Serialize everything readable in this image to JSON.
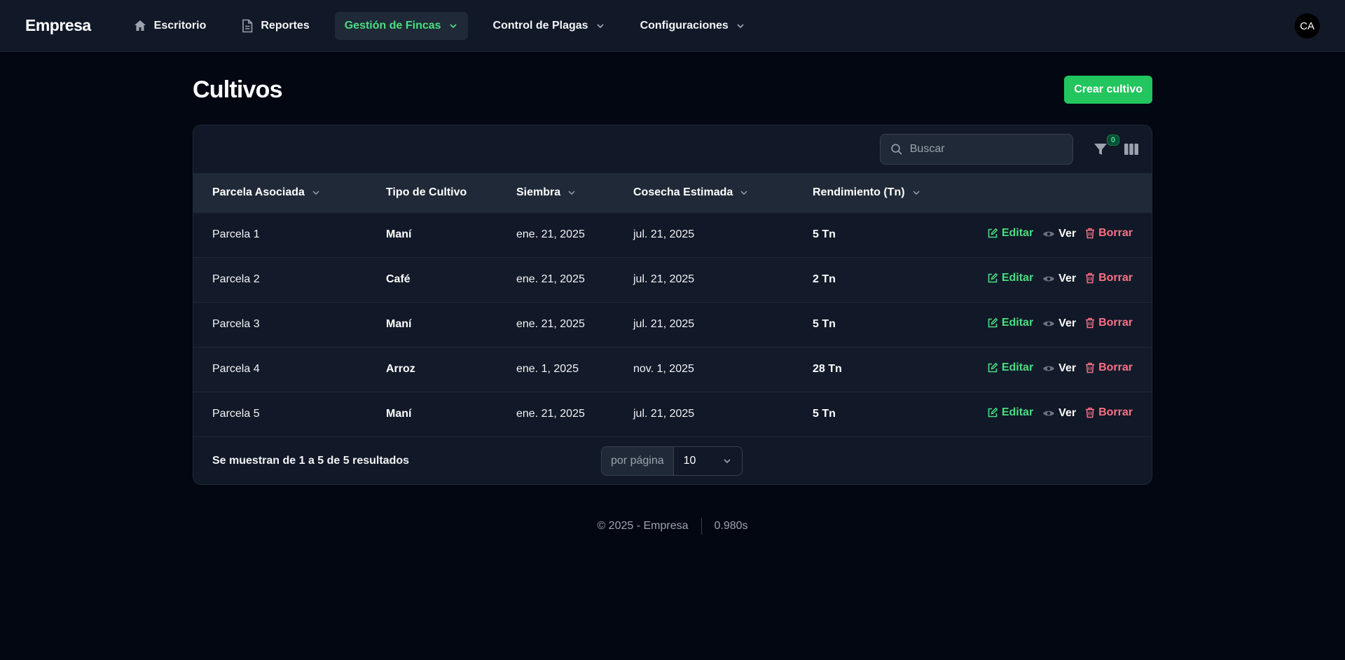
{
  "header": {
    "brand": "Empresa",
    "nav": [
      {
        "label": "Escritorio",
        "icon": "home-icon"
      },
      {
        "label": "Reportes",
        "icon": "document-icon"
      },
      {
        "label": "Gestión de Fincas",
        "icon": "chevron-down-icon",
        "active": true
      },
      {
        "label": "Control de Plagas",
        "icon": "chevron-down-icon"
      },
      {
        "label": "Configuraciones",
        "icon": "chevron-down-icon"
      }
    ],
    "avatar_initials": "CA"
  },
  "page": {
    "title": "Cultivos",
    "create_button": "Crear cultivo"
  },
  "toolbar": {
    "search_placeholder": "Buscar",
    "filter_count": "0"
  },
  "table": {
    "columns": [
      "Parcela Asociada",
      "Tipo de Cultivo",
      "Siembra",
      "Cosecha Estimada",
      "Rendimiento (Tn)"
    ],
    "actions": {
      "edit": "Editar",
      "view": "Ver",
      "delete": "Borrar"
    },
    "rows": [
      {
        "parcela": "Parcela 1",
        "tipo": "Maní",
        "siembra": "ene. 21, 2025",
        "cosecha": "jul. 21, 2025",
        "rendimiento": "5 Tn"
      },
      {
        "parcela": "Parcela 2",
        "tipo": "Café",
        "siembra": "ene. 21, 2025",
        "cosecha": "jul. 21, 2025",
        "rendimiento": "2 Tn"
      },
      {
        "parcela": "Parcela 3",
        "tipo": "Maní",
        "siembra": "ene. 21, 2025",
        "cosecha": "jul. 21, 2025",
        "rendimiento": "5 Tn"
      },
      {
        "parcela": "Parcela 4",
        "tipo": "Arroz",
        "siembra": "ene. 1, 2025",
        "cosecha": "nov. 1, 2025",
        "rendimiento": "28 Tn"
      },
      {
        "parcela": "Parcela 5",
        "tipo": "Maní",
        "siembra": "ene. 21, 2025",
        "cosecha": "jul. 21, 2025",
        "rendimiento": "5 Tn"
      }
    ]
  },
  "pagination": {
    "summary": "Se muestran de 1 a 5 de 5 resultados",
    "per_page_label": "por página",
    "per_page_value": "10"
  },
  "footer": {
    "copyright": "© 2025 - Empresa",
    "render_time": "0.980s"
  },
  "colors": {
    "background": "#030712",
    "surface": "#111827",
    "accent": "#22c55e",
    "edit": "#4ade80",
    "delete": "#fb7185"
  }
}
